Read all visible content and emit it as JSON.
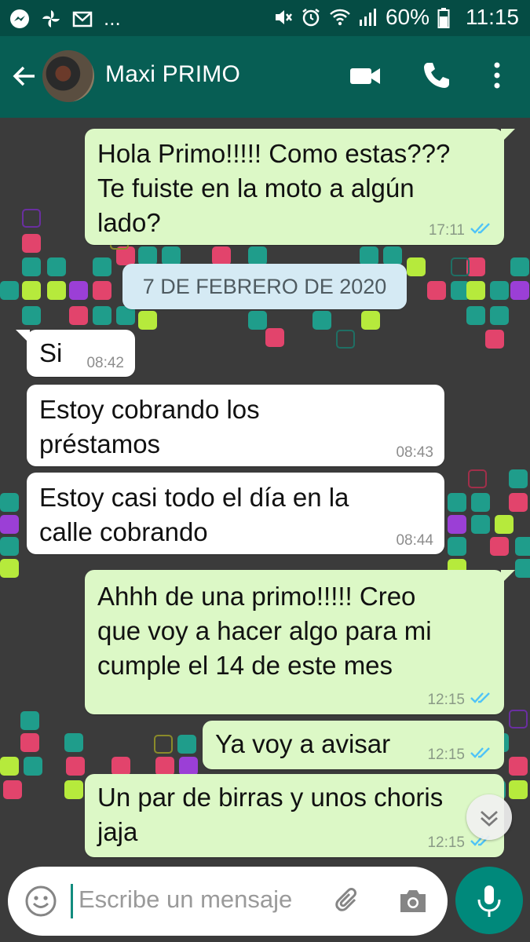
{
  "status_bar": {
    "notif_more": "...",
    "battery": "60%",
    "time": "11:15"
  },
  "header": {
    "contact_name": "Maxi PRIMO",
    "icons": [
      "back-arrow-icon",
      "video-call-icon",
      "phone-icon",
      "more-vert-icon"
    ]
  },
  "messages": [
    {
      "dir": "out",
      "lines": [
        "Hola Primo!!!!! Como estas???",
        "Te fuiste en la moto a algún",
        "lado?"
      ],
      "time": "17:11",
      "ticks": "read"
    },
    {
      "dir": "out",
      "lines": [
        "Ahhh de una primo!!!!! Creo",
        "que voy a hacer algo para mi",
        "cumple el 14 de este mes"
      ],
      "time": "12:15",
      "ticks": "read"
    },
    {
      "dir": "out",
      "lines": [
        "Ya voy a avisar"
      ],
      "time": "12:15",
      "ticks": "read"
    },
    {
      "dir": "out",
      "lines": [
        "Un par de birras y unos choris",
        "jaja"
      ],
      "time": "12:15",
      "ticks": "read"
    }
  ],
  "incoming": [
    {
      "dir": "in",
      "lines": [
        "Si"
      ],
      "time": "08:42"
    },
    {
      "dir": "in",
      "lines": [
        "Estoy cobrando los",
        "préstamos"
      ],
      "time": "08:43"
    },
    {
      "dir": "in",
      "lines": [
        "Estoy casi todo el día en la",
        "calle cobrando"
      ],
      "time": "08:44"
    }
  ],
  "date_separator": "7 DE FEBRERO DE 2020",
  "composer": {
    "placeholder": "Escribe un mensaje"
  },
  "colors": {
    "header": "#075e54",
    "status_bar": "#054c44",
    "outgoing_bubble": "#dcf8c6",
    "incoming_bubble": "#ffffff",
    "read_ticks": "#4fc3f7",
    "mic_button": "#00897b"
  }
}
